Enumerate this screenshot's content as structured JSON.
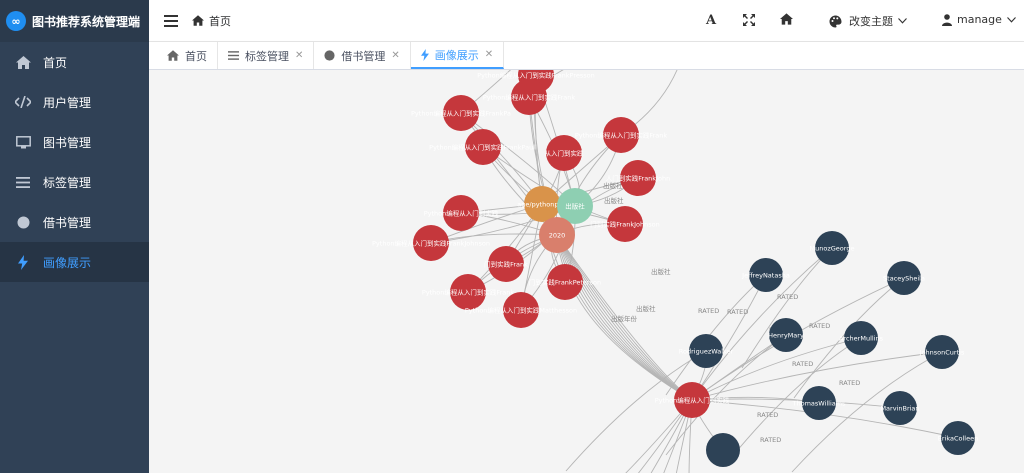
{
  "app": {
    "title": "图书推荐系统管理端",
    "logo_text": "∞"
  },
  "sidebar": {
    "items": [
      {
        "label": "首页",
        "icon": "home-icon",
        "active": false
      },
      {
        "label": "用户管理",
        "icon": "code-icon",
        "active": false
      },
      {
        "label": "图书管理",
        "icon": "monitor-icon",
        "active": false
      },
      {
        "label": "标签管理",
        "icon": "list-icon",
        "active": false
      },
      {
        "label": "借书管理",
        "icon": "circle-icon",
        "active": false
      },
      {
        "label": "画像展示",
        "icon": "lightning-icon",
        "active": true
      }
    ]
  },
  "header": {
    "breadcrumb": "首页",
    "font_btn": "A",
    "theme_label": "改变主题",
    "user_label": "manage"
  },
  "tabs": [
    {
      "label": "首页",
      "icon": "home-icon",
      "closable": false,
      "active": false
    },
    {
      "label": "标签管理",
      "icon": "list-icon",
      "closable": true,
      "active": false
    },
    {
      "label": "借书管理",
      "icon": "circle-icon",
      "closable": true,
      "active": false
    },
    {
      "label": "画像展示",
      "icon": "lightning-icon",
      "closable": true,
      "active": true
    }
  ],
  "graph": {
    "colors": {
      "book": "#c5373c",
      "user": "#2d4256",
      "publisher": "#d9934a",
      "author": "#8ecfb2",
      "year": "#d97f6c",
      "edge": "#b5b5b5"
    },
    "nodes": [
      {
        "id": "b1",
        "type": "book",
        "label": "Python编程从入门到实践FrankPresson"
      },
      {
        "id": "b2",
        "type": "book",
        "label": "Python编程从入门到实践Frank"
      },
      {
        "id": "b3",
        "type": "book",
        "label": "Python编程从入门到实践FrankPa"
      },
      {
        "id": "b4",
        "type": "book",
        "label": "Python编程从入门到实践FrankPaull"
      },
      {
        "id": "b5",
        "type": "book",
        "label": "Python编程从入门到实践Frank"
      },
      {
        "id": "b6",
        "type": "book",
        "label": "从入门到实践"
      },
      {
        "id": "b7",
        "type": "book",
        "label": "人门到实践FrankJohn"
      },
      {
        "id": "b8",
        "type": "book",
        "label": "Python编程从入门到实践"
      },
      {
        "id": "b9",
        "type": "book",
        "label": "门到实践FrankJohnson"
      },
      {
        "id": "b10",
        "type": "book",
        "label": "Python编程从入门到实践FrankJohnson"
      },
      {
        "id": "b11",
        "type": "book",
        "label": "门到实践Frank"
      },
      {
        "id": "b12",
        "type": "book",
        "label": "Python编程从入门到实践Frank"
      },
      {
        "id": "b13",
        "type": "book",
        "label": "门到实践FrankPeterson"
      },
      {
        "id": "b14",
        "type": "book",
        "label": "Python编程从入门到实践Matthesson"
      },
      {
        "id": "b15",
        "type": "book",
        "label": "Python编程从入门到实践"
      },
      {
        "id": "pub",
        "type": "publisher",
        "label": "age/pythonpub"
      },
      {
        "id": "auth",
        "type": "author",
        "label": "出版社"
      },
      {
        "id": "year",
        "type": "year",
        "label": "2020"
      },
      {
        "id": "u1",
        "type": "user",
        "label": "MunozGeorge"
      },
      {
        "id": "u2",
        "type": "user",
        "label": "JeffreyNatasha"
      },
      {
        "id": "u3",
        "type": "user",
        "label": "StaceySheila"
      },
      {
        "id": "u4",
        "type": "user",
        "label": "HenryMary"
      },
      {
        "id": "u5",
        "type": "user",
        "label": "ArcherMullins"
      },
      {
        "id": "u6",
        "type": "user",
        "label": "RodriguezWalker"
      },
      {
        "id": "u7",
        "type": "user",
        "label": "JohnsonCurtis"
      },
      {
        "id": "u8",
        "type": "user",
        "label": "ThomasWilliams"
      },
      {
        "id": "u9",
        "type": "user",
        "label": "MarvinBrian"
      },
      {
        "id": "u10",
        "type": "user",
        "label": "ErikaColleen"
      },
      {
        "id": "u11",
        "type": "user",
        "label": ""
      }
    ],
    "edge_labels": {
      "rated": "RATED",
      "published": "出版社",
      "pub_year": "出版年份"
    }
  }
}
